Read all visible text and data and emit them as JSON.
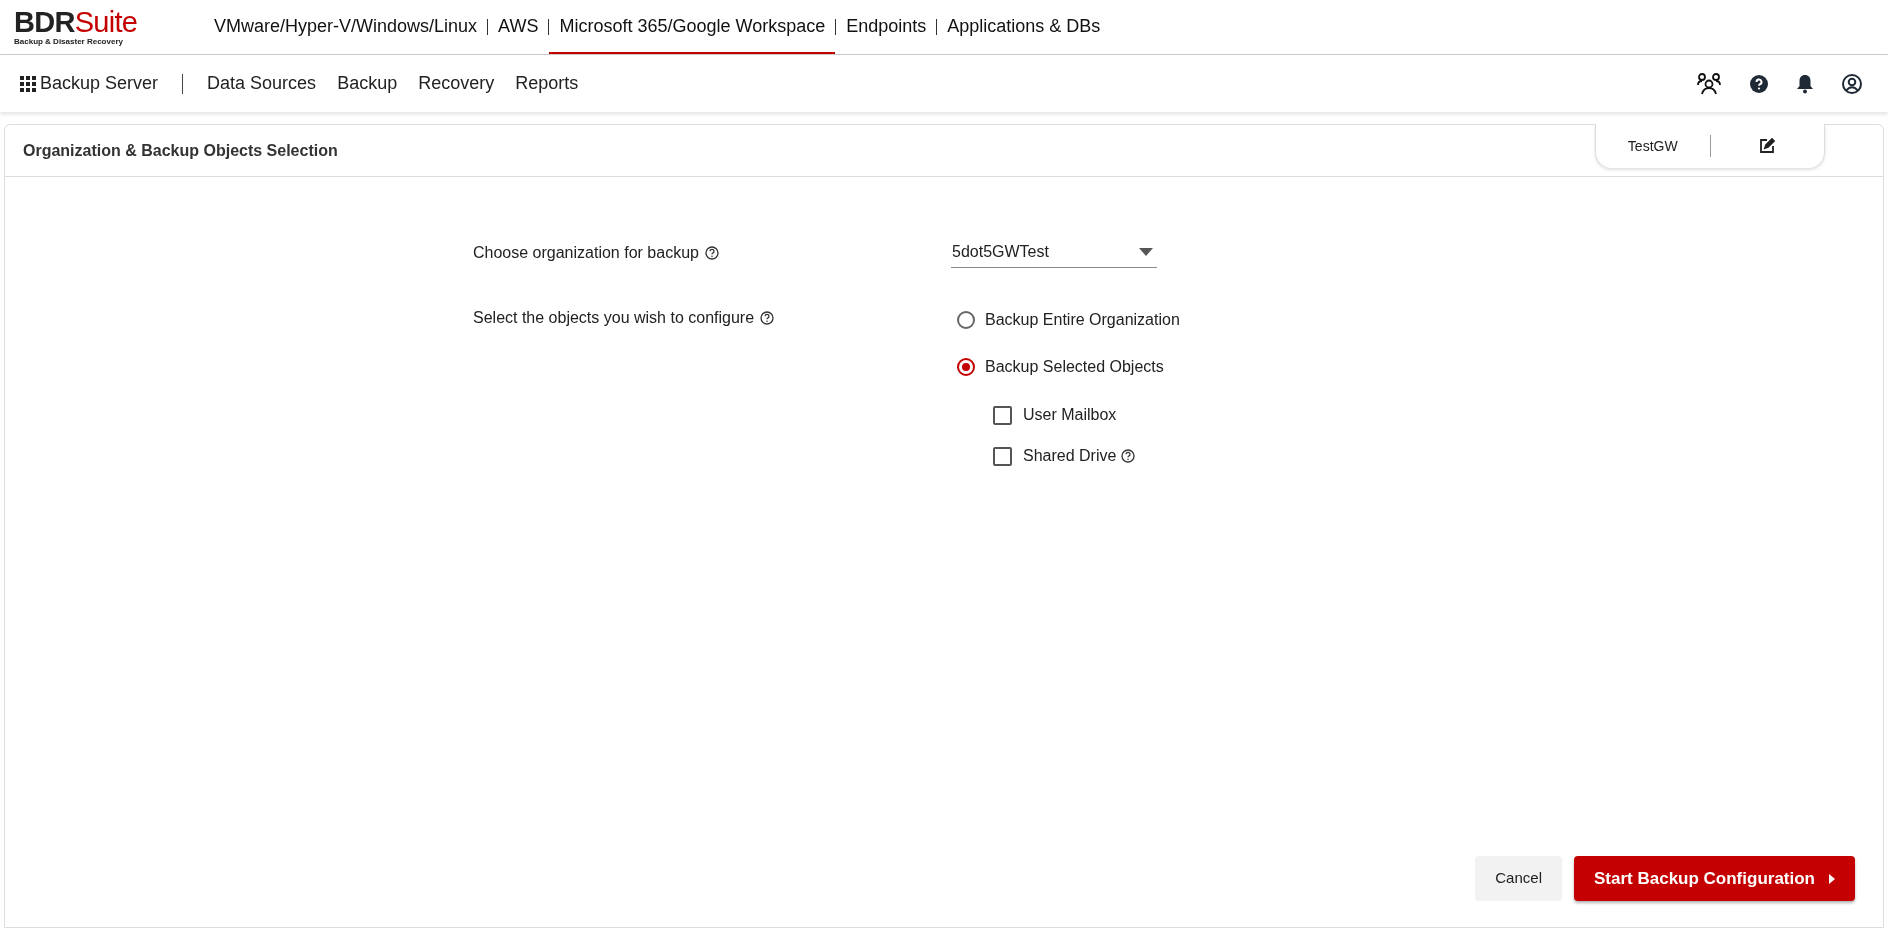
{
  "logo": {
    "brand": "BDR",
    "brand_accent": "Suite",
    "tagline": "Backup & Disaster Recovery"
  },
  "product_tabs": [
    {
      "label": "VMware/Hyper-V/Windows/Linux",
      "selected": false
    },
    {
      "label": "AWS",
      "selected": false
    },
    {
      "label": "Microsoft 365/Google Workspace",
      "selected": true
    },
    {
      "label": "Endpoints",
      "selected": false
    },
    {
      "label": "Applications & DBs",
      "selected": false
    }
  ],
  "nav": {
    "server": "Backup Server",
    "items": [
      "Data Sources",
      "Backup",
      "Recovery",
      "Reports"
    ]
  },
  "panel": {
    "title": "Organization & Backup Objects Selection",
    "job_name": "TestGW"
  },
  "form": {
    "org_label": "Choose organization for backup",
    "org_value": "5dot5GWTest",
    "objects_label": "Select the objects you wish to configure",
    "options": [
      {
        "label": "Backup Entire Organization",
        "selected": false
      },
      {
        "label": "Backup Selected Objects",
        "selected": true
      }
    ],
    "objects": [
      {
        "label": "User Mailbox",
        "checked": false,
        "help": false
      },
      {
        "label": "Shared Drive",
        "checked": false,
        "help": true
      }
    ]
  },
  "buttons": {
    "cancel": "Cancel",
    "start": "Start Backup Configuration"
  }
}
